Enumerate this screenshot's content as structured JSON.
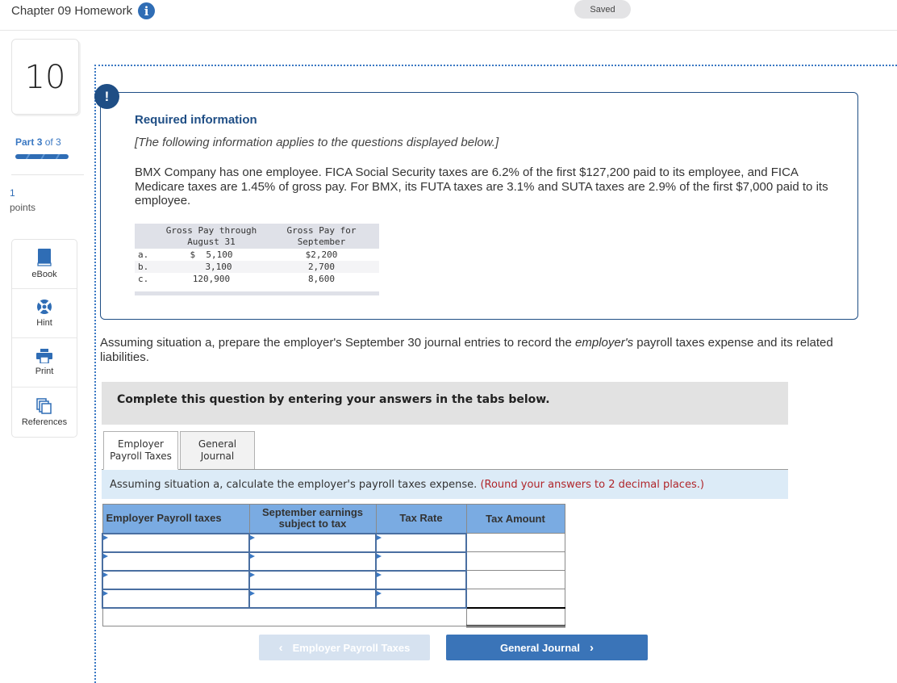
{
  "header": {
    "title": "Chapter 09 Homework",
    "saved_label": "Saved"
  },
  "sidebar": {
    "question_number": "10",
    "part_label": "Part",
    "part_current": "3",
    "part_of": "of 3",
    "part_progress": 1.0,
    "points_value": "1",
    "points_label": "points",
    "tools": [
      {
        "label": "eBook",
        "icon": "book-icon"
      },
      {
        "label": "Hint",
        "icon": "lifebuoy-icon"
      },
      {
        "label": "Print",
        "icon": "printer-icon"
      },
      {
        "label": "References",
        "icon": "copies-icon"
      }
    ]
  },
  "required_info": {
    "title": "Required information",
    "subtitle": "[The following information applies to the questions displayed below.]",
    "body": "BMX Company has one employee. FICA Social Security taxes are 6.2% of the first $127,200 paid to its employee, and FICA Medicare taxes are 1.45% of gross pay. For BMX, its FUTA taxes are 3.1% and SUTA taxes are 2.9% of the first $7,000 paid to its employee.",
    "table": {
      "headers": [
        "",
        "Gross Pay through\nAugust 31",
        "Gross Pay for\nSeptember"
      ],
      "header_lines": {
        "c1a": "Gross Pay through",
        "c1b": "August 31",
        "c2a": "Gross Pay for",
        "c2b": "September"
      },
      "rows": [
        {
          "label": "a.",
          "august": "$  5,100",
          "september": "$2,200"
        },
        {
          "label": "b.",
          "august": "3,100",
          "september": "2,700"
        },
        {
          "label": "c.",
          "august": "120,900",
          "september": "8,600"
        }
      ]
    }
  },
  "question": {
    "text_pre": "Assuming situation a, prepare the employer's September 30 journal entries to record the ",
    "text_em": "employer's",
    "text_post": " payroll taxes expense and its related liabilities.",
    "complete_instruction": "Complete this question by entering your answers in the tabs below."
  },
  "tabs": [
    {
      "line1": "Employer",
      "line2": "Payroll Taxes",
      "active": true
    },
    {
      "line1": "General",
      "line2": "Journal",
      "active": false
    }
  ],
  "instruction": {
    "text": "Assuming situation a, calculate the employer's payroll taxes expense.",
    "note": "(Round your answers to 2 decimal places.)"
  },
  "answer_table": {
    "headers": [
      "Employer Payroll taxes",
      "September earnings subject to tax",
      "Tax Rate",
      "Tax Amount"
    ],
    "header2_lines": [
      "September earnings",
      "subject to tax"
    ],
    "rows": [
      {
        "tax": "",
        "earnings": "",
        "rate": "",
        "amount": ""
      },
      {
        "tax": "",
        "earnings": "",
        "rate": "",
        "amount": ""
      },
      {
        "tax": "",
        "earnings": "",
        "rate": "",
        "amount": ""
      },
      {
        "tax": "",
        "earnings": "",
        "rate": "",
        "amount": ""
      }
    ],
    "total": ""
  },
  "nav": {
    "prev_label": "Employer Payroll Taxes",
    "next_label": "General Journal"
  },
  "colors": {
    "accent": "#2f6db5",
    "dark_blue": "#1f4e85",
    "table_header": "#7aabe2",
    "instruction_bg": "#dcebf7",
    "note_red": "#b0252a",
    "next_button": "#3a74b8",
    "prev_button_disabled": "#d6e2f0"
  }
}
